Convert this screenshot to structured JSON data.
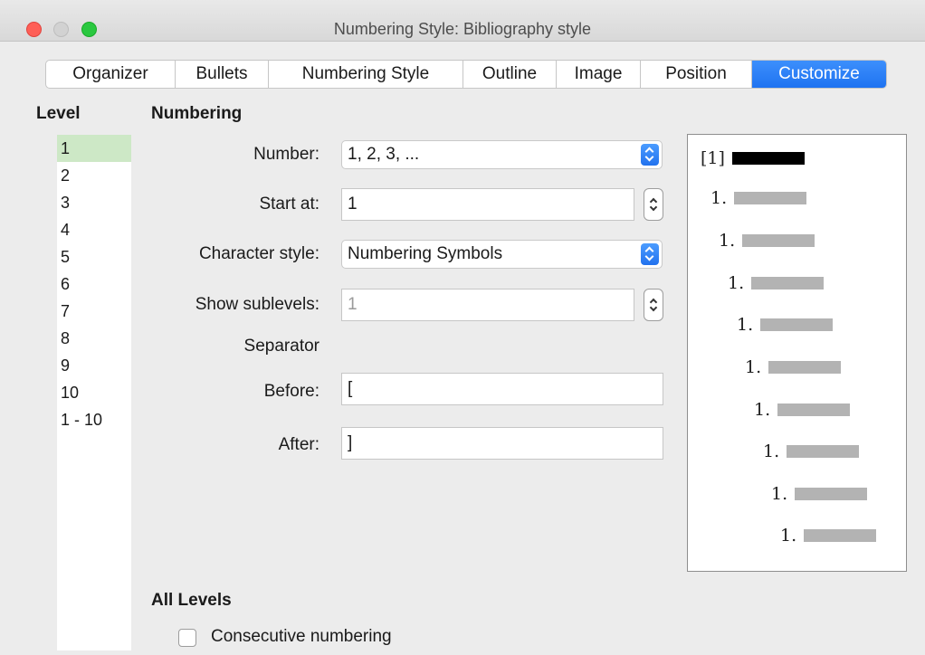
{
  "window": {
    "title": "Numbering Style: Bibliography style"
  },
  "tabs": [
    {
      "label": "Organizer"
    },
    {
      "label": "Bullets"
    },
    {
      "label": "Numbering Style"
    },
    {
      "label": "Outline"
    },
    {
      "label": "Image"
    },
    {
      "label": "Position"
    },
    {
      "label": "Customize",
      "active": true
    }
  ],
  "level": {
    "heading": "Level",
    "items": [
      "1",
      "2",
      "3",
      "4",
      "5",
      "6",
      "7",
      "8",
      "9",
      "10",
      "1 - 10"
    ],
    "selected": "1"
  },
  "numbering": {
    "heading": "Numbering",
    "number_label": "Number:",
    "number_value": "1, 2, 3, ...",
    "start_at_label": "Start at:",
    "start_at_value": "1",
    "char_style_label": "Character style:",
    "char_style_value": "Numbering Symbols",
    "show_sublevels_label": "Show sublevels:",
    "show_sublevels_value": "1",
    "separator_label": "Separator",
    "before_label": "Before:",
    "before_value": "[",
    "after_label": "After:",
    "after_value": "]"
  },
  "preview": {
    "first": "[1]",
    "rest": [
      "1.",
      "1.",
      "1.",
      "1.",
      "1.",
      "1.",
      "1.",
      "1.",
      "1."
    ]
  },
  "all_levels": {
    "heading": "All Levels",
    "consecutive_label": "Consecutive numbering",
    "consecutive_checked": false
  },
  "colors": {
    "accent": "#1f73f1",
    "selected_level": "#cde8c6",
    "close": "#fe5f57",
    "maximize": "#2ac840"
  }
}
